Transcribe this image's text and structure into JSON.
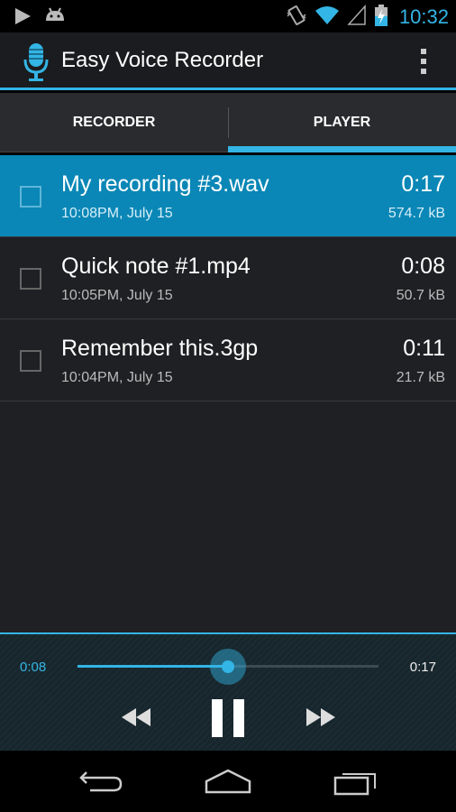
{
  "status_bar": {
    "time": "10:32",
    "icons": [
      "play-store-icon",
      "android-debug-icon",
      "vibrate-icon",
      "wifi-icon",
      "signal-icon",
      "battery-charging-icon"
    ]
  },
  "action_bar": {
    "title": "Easy Voice Recorder",
    "icon": "microphone-icon"
  },
  "tabs": [
    {
      "label": "RECORDER",
      "selected": false
    },
    {
      "label": "PLAYER",
      "selected": true
    }
  ],
  "recordings": [
    {
      "name": "My recording #3.wav",
      "date": "10:08PM, July 15",
      "duration": "0:17",
      "size": "574.7 kB",
      "selected": true
    },
    {
      "name": "Quick note #1.mp4",
      "date": "10:05PM, July 15",
      "duration": "0:08",
      "size": "50.7 kB",
      "selected": false
    },
    {
      "name": "Remember this.3gp",
      "date": "10:04PM, July 15",
      "duration": "0:11",
      "size": "21.7 kB",
      "selected": false
    }
  ],
  "player": {
    "current_time": "0:08",
    "total_time": "0:17",
    "progress": 0.5,
    "state": "playing"
  },
  "colors": {
    "accent": "#33b5e5",
    "selected_row": "#0a87b6"
  }
}
